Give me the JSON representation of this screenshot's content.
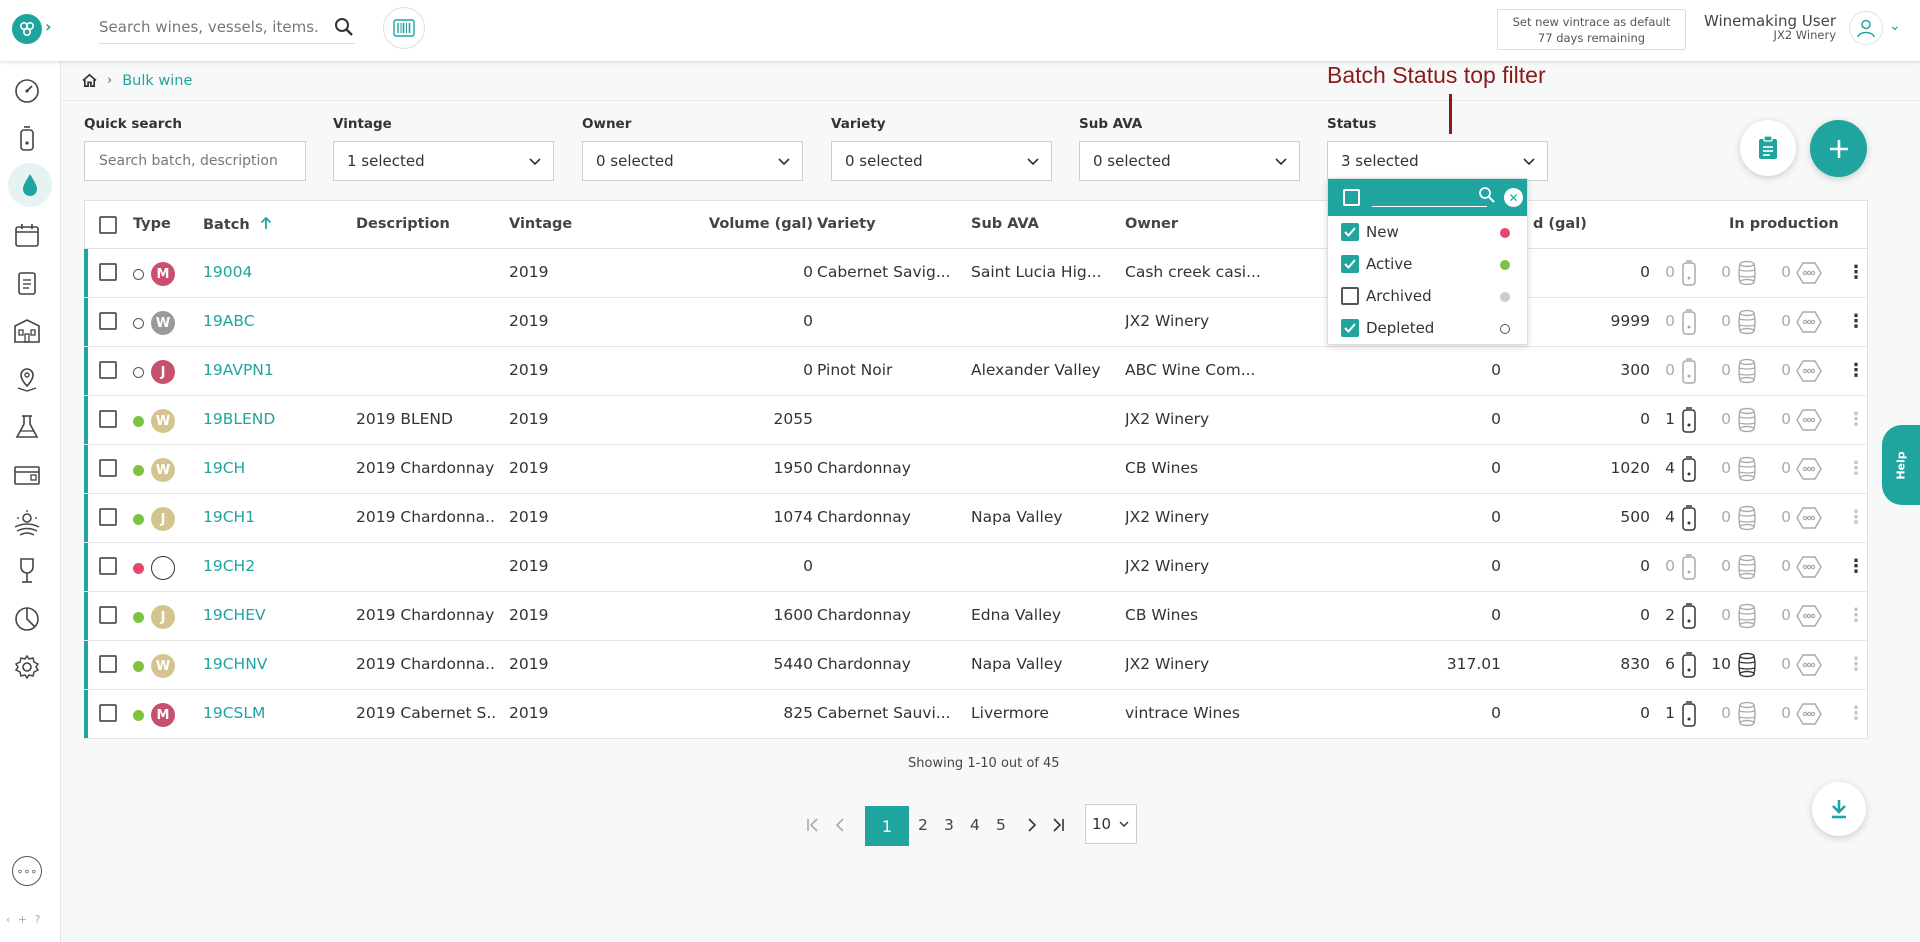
{
  "topbar": {
    "search_placeholder": "Search wines, vessels, items...",
    "default_line1": "Set new vintrace as default",
    "default_line2": "77 days remaining",
    "user_name": "Winemaking User",
    "user_org": "JX2 Winery"
  },
  "breadcrumb": {
    "current": "Bulk wine"
  },
  "annotation": "Batch Status top filter",
  "filters": {
    "quick_search": {
      "label": "Quick search",
      "placeholder": "Search batch, description"
    },
    "vintage": {
      "label": "Vintage",
      "value": "1 selected"
    },
    "owner": {
      "label": "Owner",
      "value": "0 selected"
    },
    "variety": {
      "label": "Variety",
      "value": "0 selected"
    },
    "sub_ava": {
      "label": "Sub AVA",
      "value": "0 selected"
    },
    "status": {
      "label": "Status",
      "value": "3 selected"
    }
  },
  "status_dropdown": {
    "options": [
      {
        "label": "New",
        "checked": true,
        "dot": "#e8456a",
        "dot_style": "filled"
      },
      {
        "label": "Active",
        "checked": true,
        "dot": "#7dc242",
        "dot_style": "filled"
      },
      {
        "label": "Archived",
        "checked": false,
        "dot": "#cccccc",
        "dot_style": "filled"
      },
      {
        "label": "Depleted",
        "checked": true,
        "dot": "#555555",
        "dot_style": "outline"
      }
    ]
  },
  "table": {
    "headers": {
      "type": "Type",
      "batch": "Batch",
      "description": "Description",
      "vintage": "Vintage",
      "volume": "Volume (gal)",
      "variety": "Variety",
      "sub_ava": "Sub AVA",
      "owner": "Owner",
      "partial_gal": "d (gal)",
      "in_production": "In production"
    },
    "rows": [
      {
        "status": "#555555",
        "status_style": "outline",
        "badge": "M",
        "badge_color": "#c8506e",
        "batch": "19004",
        "description": "",
        "vintage": "2019",
        "volume": "0",
        "variety": "Cabernet Savig...",
        "sub_ava": "Saint Lucia Hig...",
        "owner": "Cash creek casi...",
        "col9": "",
        "col10": "0",
        "tanks": "0",
        "barrels": "0",
        "other": "0",
        "tanks_active": false,
        "barrels_active": false,
        "kebab_active": true
      },
      {
        "status": "#555555",
        "status_style": "outline",
        "badge": "W",
        "badge_color": "#9a9a9a",
        "batch": "19ABC",
        "description": "",
        "vintage": "2019",
        "volume": "0",
        "variety": "",
        "sub_ava": "",
        "owner": "JX2 Winery",
        "col9": "",
        "col10": "9999",
        "tanks": "0",
        "barrels": "0",
        "other": "0",
        "tanks_active": false,
        "barrels_active": false,
        "kebab_active": true
      },
      {
        "status": "#555555",
        "status_style": "outline",
        "badge": "J",
        "badge_color": "#c8506e",
        "batch": "19AVPN1",
        "description": "",
        "vintage": "2019",
        "volume": "0",
        "variety": "Pinot Noir",
        "sub_ava": "Alexander Valley",
        "owner": "ABC Wine Com...",
        "col9": "0",
        "col10": "300",
        "tanks": "0",
        "barrels": "0",
        "other": "0",
        "tanks_active": false,
        "barrels_active": false,
        "kebab_active": true
      },
      {
        "status": "#7dc242",
        "status_style": "filled",
        "badge": "W",
        "badge_color": "#d4c590",
        "batch": "19BLEND",
        "description": "2019 BLEND",
        "vintage": "2019",
        "volume": "2055",
        "variety": "",
        "sub_ava": "",
        "owner": "JX2 Winery",
        "col9": "0",
        "col10": "0",
        "tanks": "1",
        "barrels": "0",
        "other": "0",
        "tanks_active": true,
        "barrels_active": false,
        "kebab_active": false
      },
      {
        "status": "#7dc242",
        "status_style": "filled",
        "badge": "W",
        "badge_color": "#d4c590",
        "batch": "19CH",
        "description": "2019 Chardonnay",
        "vintage": "2019",
        "volume": "1950",
        "variety": "Chardonnay",
        "sub_ava": "",
        "owner": "CB Wines",
        "col9": "0",
        "col10": "1020",
        "tanks": "4",
        "barrels": "0",
        "other": "0",
        "tanks_active": true,
        "barrels_active": false,
        "kebab_active": false
      },
      {
        "status": "#7dc242",
        "status_style": "filled",
        "badge": "J",
        "badge_color": "#d4c590",
        "batch": "19CH1",
        "description": "2019 Chardonna...",
        "vintage": "2019",
        "volume": "1074",
        "variety": "Chardonnay",
        "sub_ava": "Napa Valley",
        "owner": "JX2 Winery",
        "col9": "0",
        "col10": "500",
        "tanks": "4",
        "barrels": "0",
        "other": "0",
        "tanks_active": true,
        "barrels_active": false,
        "kebab_active": false
      },
      {
        "status": "#e8456a",
        "status_style": "filled",
        "badge": "",
        "badge_color": "#ffffff",
        "batch": "19CH2",
        "description": "",
        "vintage": "2019",
        "volume": "0",
        "variety": "",
        "sub_ava": "",
        "owner": "JX2 Winery",
        "col9": "0",
        "col10": "0",
        "tanks": "0",
        "barrels": "0",
        "other": "0",
        "tanks_active": false,
        "barrels_active": false,
        "kebab_active": true
      },
      {
        "status": "#7dc242",
        "status_style": "filled",
        "badge": "J",
        "badge_color": "#d4c590",
        "batch": "19CHEV",
        "description": "2019 Chardonnay",
        "vintage": "2019",
        "volume": "1600",
        "variety": "Chardonnay",
        "sub_ava": "Edna Valley",
        "owner": "CB Wines",
        "col9": "0",
        "col10": "0",
        "tanks": "2",
        "barrels": "0",
        "other": "0",
        "tanks_active": true,
        "barrels_active": false,
        "kebab_active": false
      },
      {
        "status": "#7dc242",
        "status_style": "filled",
        "badge": "W",
        "badge_color": "#d4c590",
        "batch": "19CHNV",
        "description": "2019 Chardonna...",
        "vintage": "2019",
        "volume": "5440",
        "variety": "Chardonnay",
        "sub_ava": "Napa Valley",
        "owner": "JX2 Winery",
        "col9": "317.01",
        "col10": "830",
        "tanks": "6",
        "barrels": "10",
        "other": "0",
        "tanks_active": true,
        "barrels_active": true,
        "kebab_active": false
      },
      {
        "status": "#7dc242",
        "status_style": "filled",
        "badge": "M",
        "badge_color": "#c8506e",
        "batch": "19CSLM",
        "description": "2019 Cabernet S...",
        "vintage": "2019",
        "volume": "825",
        "variety": "Cabernet Sauvi...",
        "sub_ava": "Livermore",
        "owner": "vintrace Wines",
        "col9": "0",
        "col10": "0",
        "tanks": "1",
        "barrels": "0",
        "other": "0",
        "tanks_active": true,
        "barrels_active": false,
        "kebab_active": false
      }
    ]
  },
  "footer": {
    "showing": "Showing 1-10 out of 45",
    "pages": [
      "1",
      "2",
      "3",
      "4",
      "5"
    ],
    "current_page": "1",
    "page_size": "10"
  },
  "help_label": "Help",
  "colors": {
    "accent": "#1fa4a0",
    "annotation": "#8b1a1a"
  }
}
